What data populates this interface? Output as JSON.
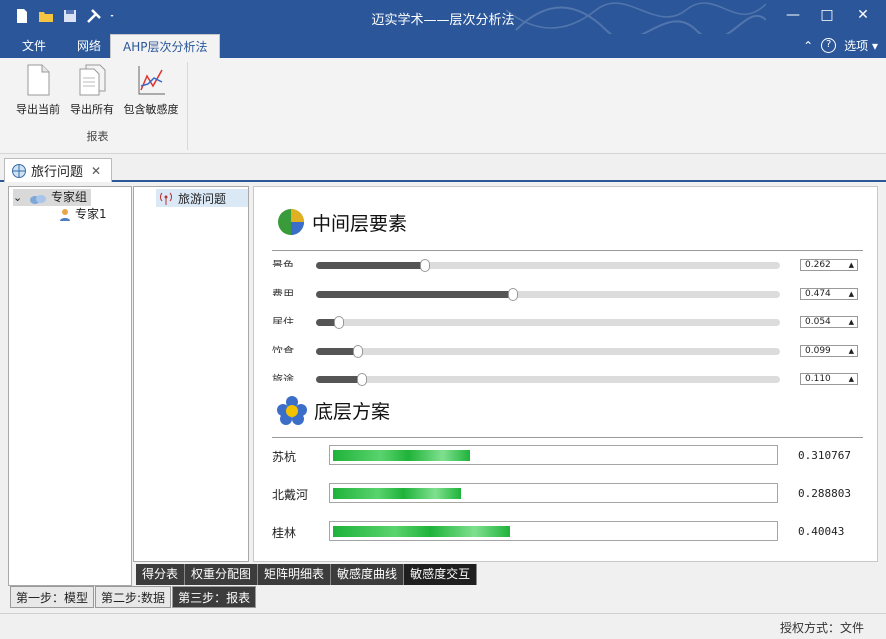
{
  "window": {
    "title": "迈实学术——层次分析法",
    "title_color": "#2b579a",
    "controls": {
      "minimize": "—",
      "maximize": "□",
      "close": "✕"
    }
  },
  "quick_access": [
    "new-file-icon",
    "open-folder-icon",
    "save-icon",
    "tools-icon",
    "dropdown-arrow-icon"
  ],
  "ribbon_tabs": [
    {
      "label": "文件",
      "active": false
    },
    {
      "label": "网络",
      "active": false
    },
    {
      "label": "AHP层次分析法",
      "active": true
    }
  ],
  "ribbon_right": {
    "collapse_glyph": "⌃",
    "help_glyph": "?",
    "options_label": "选项",
    "options_arrow": "▾"
  },
  "ribbon_group": {
    "label": "报表",
    "buttons": [
      {
        "label": "导出当前",
        "icon": "document-icon"
      },
      {
        "label": "导出所有",
        "icon": "documents-icon"
      },
      {
        "label": "包含敏感度",
        "icon": "sensitivity-chart-icon"
      }
    ]
  },
  "doc_tab": {
    "label": "旅行问题",
    "close": "✕"
  },
  "tree": {
    "group_label": "专家组",
    "expander": "⌄",
    "child_label": "专家1"
  },
  "problem_list": {
    "item": "旅游问题"
  },
  "report": {
    "section1_title": "中间层要素",
    "criteria": [
      {
        "label": "景色",
        "value": 0.262,
        "display": "0.262"
      },
      {
        "label": "费用",
        "value": 0.474,
        "display": "0.474"
      },
      {
        "label": "居住",
        "value": 0.054,
        "display": "0.054"
      },
      {
        "label": "饮食",
        "value": 0.099,
        "display": "0.099"
      },
      {
        "label": "旅途",
        "value": 0.11,
        "display": "0.110"
      }
    ],
    "section2_title": "底层方案",
    "alternatives": [
      {
        "label": "苏杭",
        "value": 0.310767,
        "display": "0.310767"
      },
      {
        "label": "北戴河",
        "value": 0.288803,
        "display": "0.288803"
      },
      {
        "label": "桂林",
        "value": 0.40043,
        "display": "0.40043"
      }
    ],
    "bar_color": "#1fb33a",
    "slider_fill_color": "#555555"
  },
  "bottom_tabs": [
    {
      "label": "得分表",
      "active": false
    },
    {
      "label": "权重分配图",
      "active": false
    },
    {
      "label": "矩阵明细表",
      "active": false
    },
    {
      "label": "敏感度曲线",
      "active": false
    },
    {
      "label": "敏感度交互",
      "active": true
    }
  ],
  "steps": [
    {
      "label": "第一步：模型",
      "active": false
    },
    {
      "label": "第二步:数据",
      "active": false
    },
    {
      "label": "第三步：报表",
      "active": true
    }
  ],
  "status": {
    "license": "授权方式：文件"
  }
}
